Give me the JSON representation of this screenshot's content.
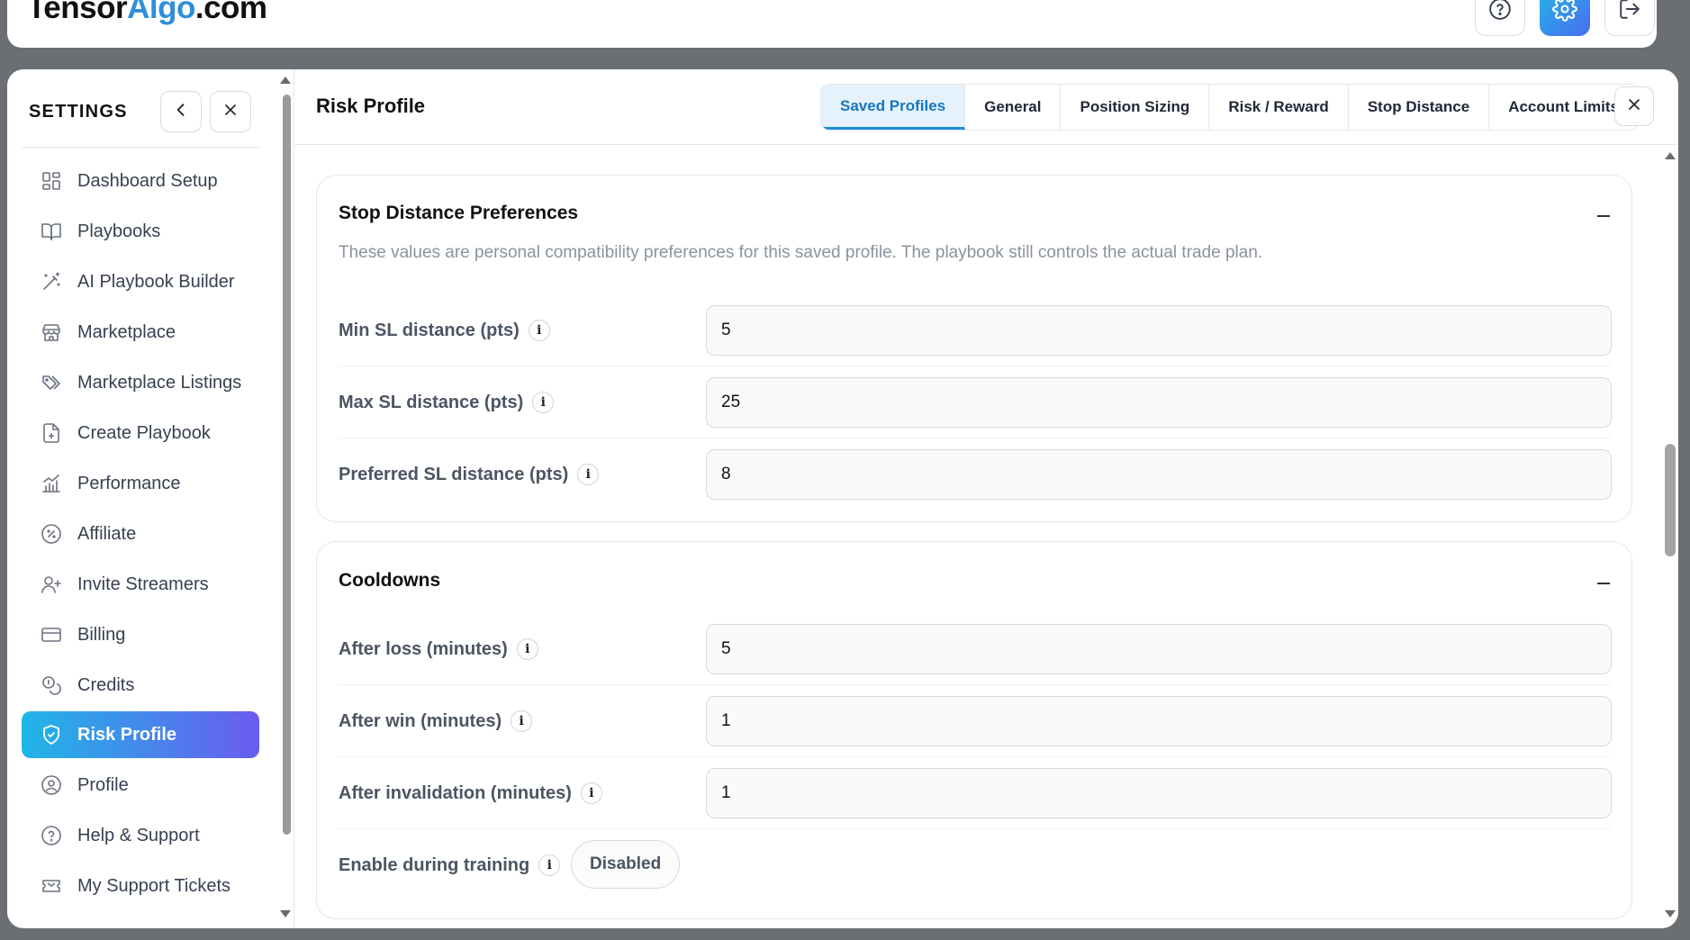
{
  "header": {
    "logo_part1": "Tensor",
    "logo_part2": "Algo",
    "logo_part3": ".com",
    "icons": [
      "help-icon",
      "settings-icon",
      "logout-icon"
    ]
  },
  "sidebar": {
    "title": "SETTINGS",
    "items": [
      {
        "label": "Dashboard Setup",
        "icon": "dashboard-icon"
      },
      {
        "label": "Playbooks",
        "icon": "book-icon"
      },
      {
        "label": "AI Playbook Builder",
        "icon": "magic-wand-icon"
      },
      {
        "label": "Marketplace",
        "icon": "store-icon"
      },
      {
        "label": "Marketplace Listings",
        "icon": "tags-icon"
      },
      {
        "label": "Create Playbook",
        "icon": "file-plus-icon"
      },
      {
        "label": "Performance",
        "icon": "chart-icon"
      },
      {
        "label": "Affiliate",
        "icon": "badge-percent-icon"
      },
      {
        "label": "Invite Streamers",
        "icon": "user-plus-icon"
      },
      {
        "label": "Billing",
        "icon": "credit-card-icon"
      },
      {
        "label": "Credits",
        "icon": "coins-icon"
      },
      {
        "label": "Risk Profile",
        "icon": "shield-icon",
        "active": true
      },
      {
        "label": "Profile",
        "icon": "user-circle-icon"
      },
      {
        "label": "Help & Support",
        "icon": "help-circle-icon"
      },
      {
        "label": "My Support Tickets",
        "icon": "ticket-icon"
      }
    ]
  },
  "content": {
    "title": "Risk Profile",
    "tabs": [
      {
        "label": "Saved Profiles",
        "active": true
      },
      {
        "label": "General"
      },
      {
        "label": "Position Sizing"
      },
      {
        "label": "Risk / Reward"
      },
      {
        "label": "Stop Distance"
      },
      {
        "label": "Account Limits"
      }
    ],
    "stop_distance": {
      "title": "Stop Distance Preferences",
      "description": "These values are personal compatibility preferences for this saved profile. The playbook still controls the actual trade plan.",
      "fields": [
        {
          "label": "Min SL distance (pts)",
          "value": "5"
        },
        {
          "label": "Max SL distance (pts)",
          "value": "25"
        },
        {
          "label": "Preferred SL distance (pts)",
          "value": "8"
        }
      ]
    },
    "cooldowns": {
      "title": "Cooldowns",
      "fields": [
        {
          "label": "After loss (minutes)",
          "value": "5"
        },
        {
          "label": "After win (minutes)",
          "value": "1"
        },
        {
          "label": "After invalidation (minutes)",
          "value": "1"
        }
      ],
      "toggle": {
        "label": "Enable during training",
        "value": "Disabled"
      }
    },
    "info_glyph": "i"
  },
  "colors": {
    "accent_start": "#1fb6e6",
    "accent_end": "#6a5cf0",
    "tab_active_text": "#1477c2",
    "logo_accent": "#2f8fd8"
  }
}
